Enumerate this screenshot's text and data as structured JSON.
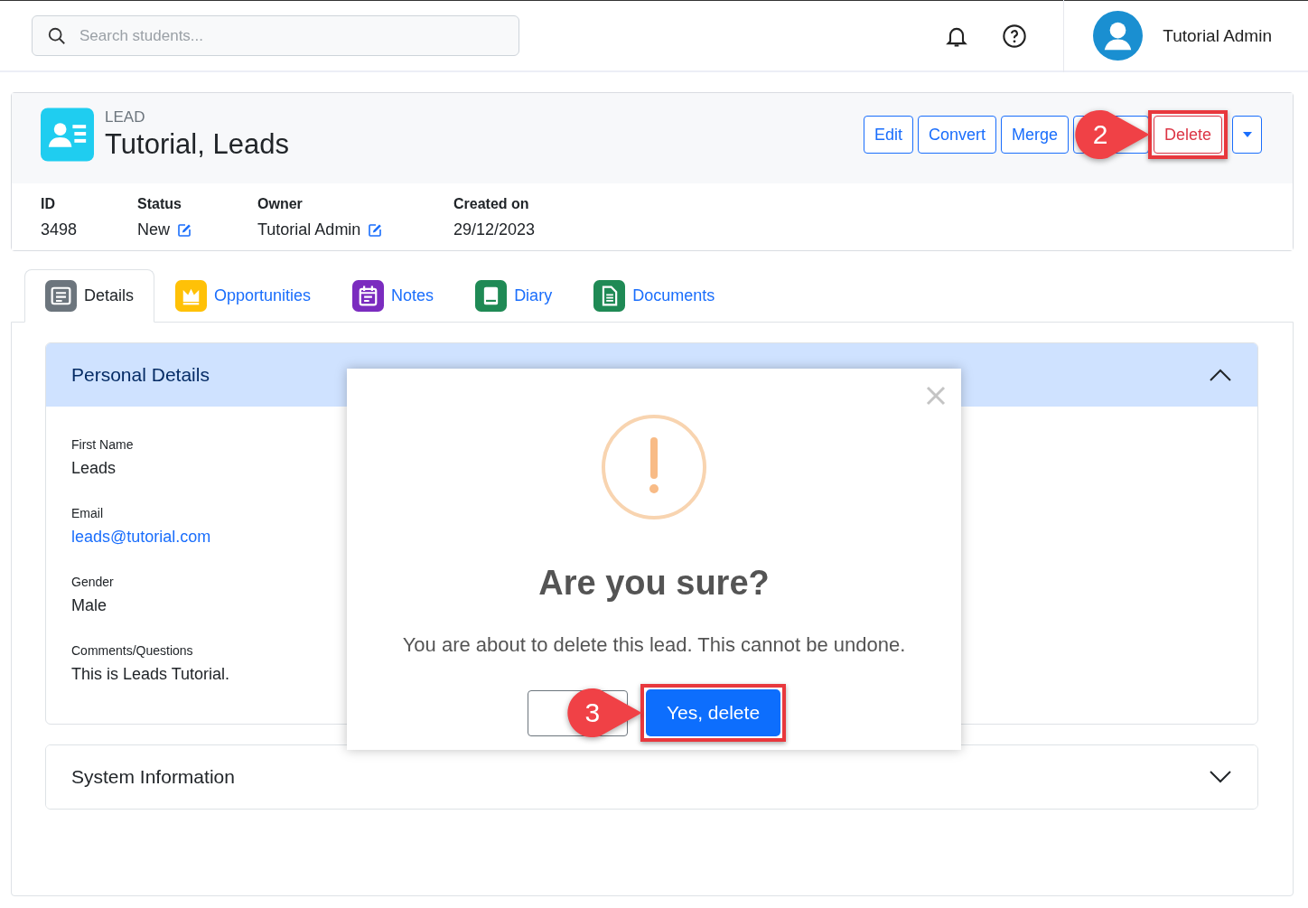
{
  "search": {
    "placeholder": "Search students..."
  },
  "user": {
    "name": "Tutorial Admin"
  },
  "record": {
    "type": "LEAD",
    "title": "Tutorial, Leads",
    "actions": [
      {
        "kind": "text",
        "label": "Edit"
      },
      {
        "kind": "text",
        "label": "Convert"
      },
      {
        "kind": "text",
        "label": "Merge"
      },
      {
        "kind": "covered"
      },
      {
        "kind": "danger",
        "label": "Delete",
        "callout": "2"
      },
      {
        "kind": "caret"
      }
    ],
    "fields": [
      {
        "label": "ID",
        "value": "3498",
        "editable": false
      },
      {
        "label": "Status",
        "value": "New",
        "editable": true
      },
      {
        "label": "Owner",
        "value": "Tutorial Admin",
        "editable": true
      },
      {
        "label": "Created on",
        "value": "29/12/2023",
        "editable": false
      }
    ]
  },
  "tabs": [
    {
      "label": "Details",
      "selected": true,
      "color": "#6c757d",
      "kind": "list"
    },
    {
      "label": "Opportunities",
      "selected": false,
      "color": "#ffc107",
      "kind": "crown"
    },
    {
      "label": "Notes",
      "selected": false,
      "color": "#7b2cbf",
      "kind": "calendar"
    },
    {
      "label": "Diary",
      "selected": false,
      "color": "#1f8a55",
      "kind": "book"
    },
    {
      "label": "Documents",
      "selected": false,
      "color": "#1f8a55",
      "kind": "document"
    }
  ],
  "sections": [
    {
      "title": "Personal Details",
      "expanded": true,
      "fields": [
        {
          "label": "First Name",
          "value": "Leads",
          "kind": "text"
        },
        {
          "label": "Email",
          "value": "leads@tutorial.com",
          "kind": "link"
        },
        {
          "label": "Gender",
          "value": "Male",
          "kind": "text"
        },
        {
          "label": "Comments/Questions",
          "value": "This is Leads Tutorial.",
          "kind": "text"
        }
      ]
    },
    {
      "title": "System Information",
      "expanded": false
    }
  ],
  "dialog": {
    "title": "Are you sure?",
    "message": "You are about to delete this lead. This cannot be undone.",
    "confirm": "Yes, delete",
    "callout": "3"
  }
}
